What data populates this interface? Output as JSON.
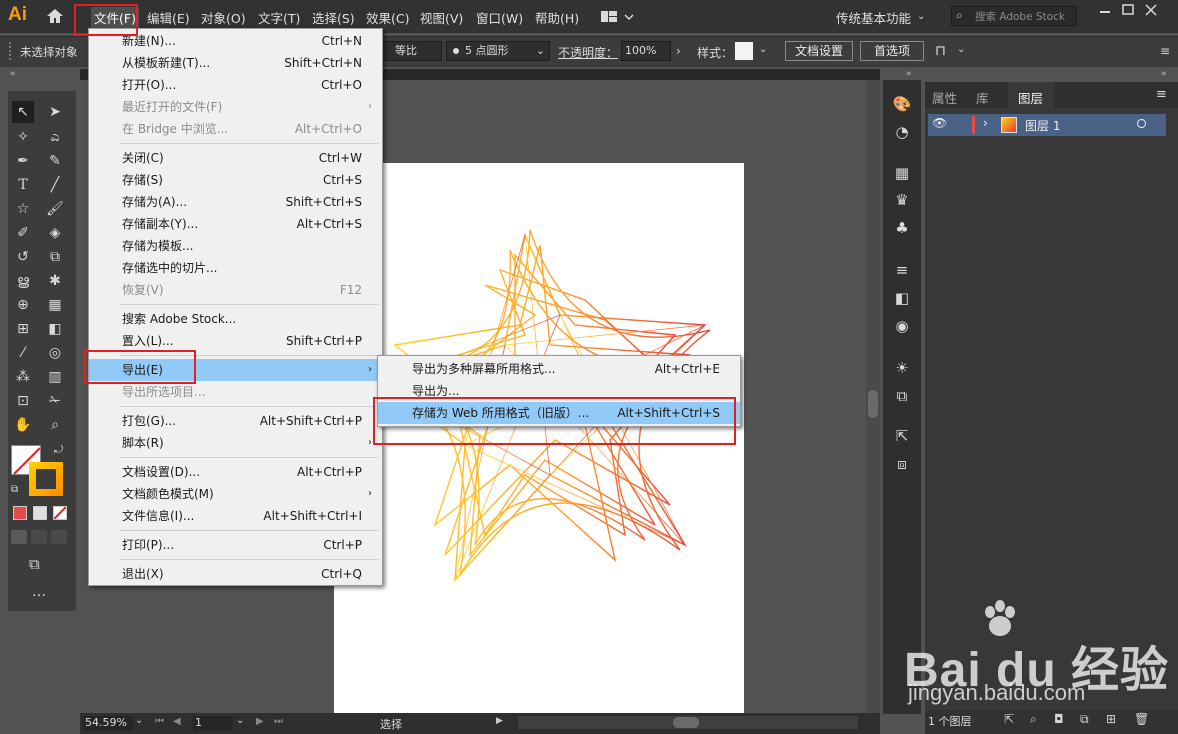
{
  "app": {
    "logo": "Ai"
  },
  "menubar": {
    "items": [
      "文件(F)",
      "编辑(E)",
      "对象(O)",
      "文字(T)",
      "选择(S)",
      "效果(C)",
      "视图(V)",
      "窗口(W)",
      "帮助(H)"
    ],
    "workspace": "传统基本功能",
    "search_placeholder": "搜索 Adobe Stock"
  },
  "control_bar": {
    "selection": "未选择对象",
    "stroke_scale": "等比",
    "brush": "5 点圆形",
    "opacity_label": "不透明度：",
    "opacity_value": "100%",
    "style_label": "样式：",
    "doc_setup": "文档设置",
    "preferences": "首选项"
  },
  "file_menu": {
    "items": [
      {
        "label": "新建(N)...",
        "shortcut": "Ctrl+N"
      },
      {
        "label": "从模板新建(T)...",
        "shortcut": "Shift+Ctrl+N"
      },
      {
        "label": "打开(O)...",
        "shortcut": "Ctrl+O"
      },
      {
        "label": "最近打开的文件(F)",
        "shortcut": ""
      },
      {
        "label": "在 Bridge 中浏览...",
        "shortcut": "Alt+Ctrl+O"
      },
      {
        "label": "关闭(C)",
        "shortcut": "Ctrl+W"
      },
      {
        "label": "存储(S)",
        "shortcut": "Ctrl+S"
      },
      {
        "label": "存储为(A)...",
        "shortcut": "Shift+Ctrl+S"
      },
      {
        "label": "存储副本(Y)...",
        "shortcut": "Alt+Ctrl+S"
      },
      {
        "label": "存储为模板...",
        "shortcut": ""
      },
      {
        "label": "存储选中的切片...",
        "shortcut": ""
      },
      {
        "label": "恢复(V)",
        "shortcut": "F12"
      },
      {
        "label": "搜索 Adobe Stock...",
        "shortcut": ""
      },
      {
        "label": "置入(L)...",
        "shortcut": "Shift+Ctrl+P"
      },
      {
        "label": "导出(E)",
        "shortcut": ""
      },
      {
        "label": "导出所选项目...",
        "shortcut": ""
      },
      {
        "label": "打包(G)...",
        "shortcut": "Alt+Shift+Ctrl+P"
      },
      {
        "label": "脚本(R)",
        "shortcut": ""
      },
      {
        "label": "文档设置(D)...",
        "shortcut": "Alt+Ctrl+P"
      },
      {
        "label": "文档颜色模式(M)",
        "shortcut": ""
      },
      {
        "label": "文件信息(I)...",
        "shortcut": "Alt+Shift+Ctrl+I"
      },
      {
        "label": "打印(P)...",
        "shortcut": "Ctrl+P"
      },
      {
        "label": "退出(X)",
        "shortcut": "Ctrl+Q"
      }
    ]
  },
  "export_submenu": {
    "items": [
      {
        "label": "导出为多种屏幕所用格式...",
        "shortcut": "Alt+Ctrl+E"
      },
      {
        "label": "导出为...",
        "shortcut": ""
      },
      {
        "label": "存储为 Web 所用格式（旧版）...",
        "shortcut": "Alt+Shift+Ctrl+S"
      }
    ]
  },
  "layers_panel": {
    "tabs": [
      "属性",
      "库",
      "图层"
    ],
    "layer_name": "图层 1",
    "footer": "1 个图层"
  },
  "status_bar": {
    "zoom": "54.59%",
    "artboard": "1",
    "tool": "选择"
  },
  "watermark": {
    "logo": "Bai du 经验",
    "url": "jingyan.baidu.com"
  },
  "colors": {
    "accent": "#ff9a00",
    "highlight": "#91c9f7",
    "annotation": "#e02020",
    "layer_color": "#e64b4b"
  }
}
